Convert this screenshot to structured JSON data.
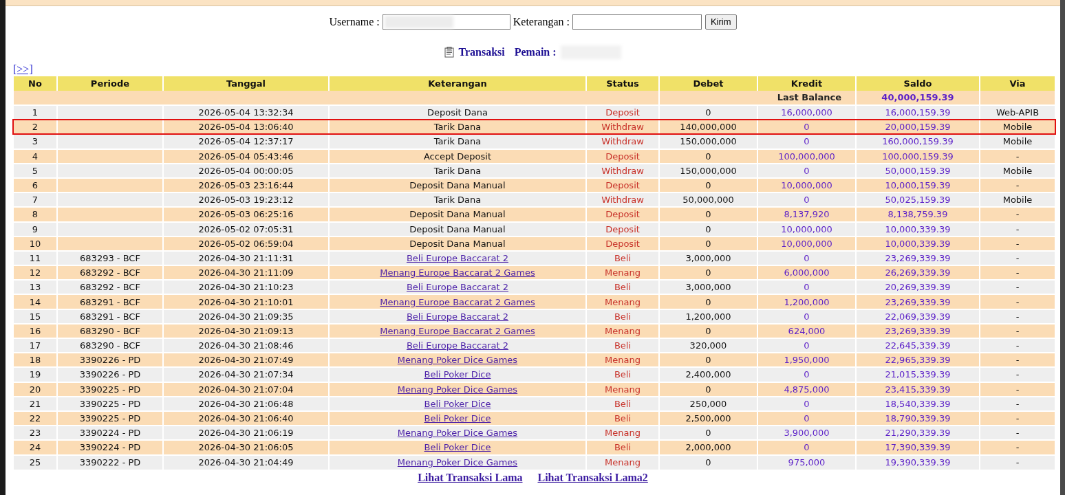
{
  "form": {
    "username_label": "Username :",
    "keterangan_label": "Keterangan :",
    "submit": "Kirim"
  },
  "heading": {
    "title": "Transaksi",
    "player_label": "Pemain :"
  },
  "next_link": "[>>]",
  "table": {
    "columns": [
      "No",
      "Periode",
      "Tanggal",
      "Keterangan",
      "Status",
      "Debet",
      "Kredit",
      "Saldo",
      "Via"
    ],
    "last_balance": {
      "label": "Last Balance",
      "value": "40,000,159.39"
    },
    "rows": [
      {
        "no": "1",
        "tanggal": "2026-05-04 13:32:34",
        "keterangan": "Deposit Dana",
        "link": false,
        "status": "Deposit",
        "debet": "0",
        "kredit": "16,000,000",
        "saldo": "16,000,159.39",
        "via": "Web-APIB",
        "highlighted": false
      },
      {
        "no": "2",
        "tanggal": "2026-05-04 13:06:40",
        "keterangan": "Tarik Dana",
        "link": false,
        "status": "Withdraw",
        "debet": "140,000,000",
        "kredit": "0",
        "saldo": "20,000,159.39",
        "via": "Mobile",
        "highlighted": true
      },
      {
        "no": "3",
        "tanggal": "2026-05-04 12:37:17",
        "keterangan": "Tarik Dana",
        "link": false,
        "status": "Withdraw",
        "debet": "150,000,000",
        "kredit": "0",
        "saldo": "160,000,159.39",
        "via": "Mobile",
        "highlighted": false
      },
      {
        "no": "4",
        "tanggal": "2026-05-04 05:43:46",
        "keterangan": "Accept Deposit",
        "link": false,
        "status": "Deposit",
        "debet": "0",
        "kredit": "100,000,000",
        "saldo": "100,000,159.39",
        "via": "-",
        "highlighted": false
      },
      {
        "no": "5",
        "tanggal": "2026-05-04 00:00:05",
        "keterangan": "Tarik Dana",
        "link": false,
        "status": "Withdraw",
        "debet": "150,000,000",
        "kredit": "0",
        "saldo": "50,000,159.39",
        "via": "Mobile",
        "highlighted": false
      },
      {
        "no": "6",
        "tanggal": "2026-05-03 23:16:44",
        "keterangan": "Deposit Dana Manual",
        "link": false,
        "status": "Deposit",
        "debet": "0",
        "kredit": "10,000,000",
        "saldo": "10,000,159.39",
        "via": "-",
        "highlighted": false
      },
      {
        "no": "7",
        "tanggal": "2026-05-03 19:23:12",
        "keterangan": "Tarik Dana",
        "link": false,
        "status": "Withdraw",
        "debet": "50,000,000",
        "kredit": "0",
        "saldo": "50,025,159.39",
        "via": "Mobile",
        "highlighted": false
      },
      {
        "no": "8",
        "tanggal": "2026-05-03 06:25:16",
        "keterangan": "Deposit Dana Manual",
        "link": false,
        "status": "Deposit",
        "debet": "0",
        "kredit": "8,137,920",
        "saldo": "8,138,759.39",
        "via": "-",
        "highlighted": false
      },
      {
        "no": "9",
        "tanggal": "2026-05-02 07:05:31",
        "keterangan": "Deposit Dana Manual",
        "link": false,
        "status": "Deposit",
        "debet": "0",
        "kredit": "10,000,000",
        "saldo": "10,000,339.39",
        "via": "-",
        "highlighted": false
      },
      {
        "no": "10",
        "tanggal": "2026-05-02 06:59:04",
        "keterangan": "Deposit Dana Manual",
        "link": false,
        "status": "Deposit",
        "debet": "0",
        "kredit": "10,000,000",
        "saldo": "10,000,339.39",
        "via": "-",
        "highlighted": false
      },
      {
        "no": "11",
        "periode": "683293 - BCF",
        "tanggal": "2026-04-30 21:11:31",
        "keterangan": "Beli Europe Baccarat 2",
        "link": true,
        "status": "Beli",
        "debet": "3,000,000",
        "kredit": "0",
        "saldo": "23,269,339.39",
        "via": "-",
        "highlighted": false
      },
      {
        "no": "12",
        "periode": "683292 - BCF",
        "tanggal": "2026-04-30 21:11:09",
        "keterangan": "Menang Europe Baccarat 2 Games",
        "link": true,
        "status": "Menang",
        "debet": "0",
        "kredit": "6,000,000",
        "saldo": "26,269,339.39",
        "via": "-",
        "highlighted": false
      },
      {
        "no": "13",
        "periode": "683292 - BCF",
        "tanggal": "2026-04-30 21:10:23",
        "keterangan": "Beli Europe Baccarat 2",
        "link": true,
        "status": "Beli",
        "debet": "3,000,000",
        "kredit": "0",
        "saldo": "20,269,339.39",
        "via": "-",
        "highlighted": false
      },
      {
        "no": "14",
        "periode": "683291 - BCF",
        "tanggal": "2026-04-30 21:10:01",
        "keterangan": "Menang Europe Baccarat 2 Games",
        "link": true,
        "status": "Menang",
        "debet": "0",
        "kredit": "1,200,000",
        "saldo": "23,269,339.39",
        "via": "-",
        "highlighted": false
      },
      {
        "no": "15",
        "periode": "683291 - BCF",
        "tanggal": "2026-04-30 21:09:35",
        "keterangan": "Beli Europe Baccarat 2",
        "link": true,
        "status": "Beli",
        "debet": "1,200,000",
        "kredit": "0",
        "saldo": "22,069,339.39",
        "via": "-",
        "highlighted": false
      },
      {
        "no": "16",
        "periode": "683290 - BCF",
        "tanggal": "2026-04-30 21:09:13",
        "keterangan": "Menang Europe Baccarat 2 Games",
        "link": true,
        "status": "Menang",
        "debet": "0",
        "kredit": "624,000",
        "saldo": "23,269,339.39",
        "via": "-",
        "highlighted": false
      },
      {
        "no": "17",
        "periode": "683290 - BCF",
        "tanggal": "2026-04-30 21:08:46",
        "keterangan": "Beli Europe Baccarat 2",
        "link": true,
        "status": "Beli",
        "debet": "320,000",
        "kredit": "0",
        "saldo": "22,645,339.39",
        "via": "-",
        "highlighted": false
      },
      {
        "no": "18",
        "periode": "3390226 - PD",
        "tanggal": "2026-04-30 21:07:49",
        "keterangan": "Menang Poker Dice Games",
        "link": true,
        "status": "Menang",
        "debet": "0",
        "kredit": "1,950,000",
        "saldo": "22,965,339.39",
        "via": "-",
        "highlighted": false
      },
      {
        "no": "19",
        "periode": "3390226 - PD",
        "tanggal": "2026-04-30 21:07:34",
        "keterangan": "Beli Poker Dice",
        "link": true,
        "status": "Beli",
        "debet": "2,400,000",
        "kredit": "0",
        "saldo": "21,015,339.39",
        "via": "-",
        "highlighted": false
      },
      {
        "no": "20",
        "periode": "3390225 - PD",
        "tanggal": "2026-04-30 21:07:04",
        "keterangan": "Menang Poker Dice Games",
        "link": true,
        "status": "Menang",
        "debet": "0",
        "kredit": "4,875,000",
        "saldo": "23,415,339.39",
        "via": "-",
        "highlighted": false
      },
      {
        "no": "21",
        "periode": "3390225 - PD",
        "tanggal": "2026-04-30 21:06:48",
        "keterangan": "Beli Poker Dice",
        "link": true,
        "status": "Beli",
        "debet": "250,000",
        "kredit": "0",
        "saldo": "18,540,339.39",
        "via": "-",
        "highlighted": false
      },
      {
        "no": "22",
        "periode": "3390225 - PD",
        "tanggal": "2026-04-30 21:06:40",
        "keterangan": "Beli Poker Dice",
        "link": true,
        "status": "Beli",
        "debet": "2,500,000",
        "kredit": "0",
        "saldo": "18,790,339.39",
        "via": "-",
        "highlighted": false
      },
      {
        "no": "23",
        "periode": "3390224 - PD",
        "tanggal": "2026-04-30 21:06:19",
        "keterangan": "Menang Poker Dice Games",
        "link": true,
        "status": "Menang",
        "debet": "0",
        "kredit": "3,900,000",
        "saldo": "21,290,339.39",
        "via": "-",
        "highlighted": false
      },
      {
        "no": "24",
        "periode": "3390224 - PD",
        "tanggal": "2026-04-30 21:06:05",
        "keterangan": "Beli Poker Dice",
        "link": true,
        "status": "Beli",
        "debet": "2,000,000",
        "kredit": "0",
        "saldo": "17,390,339.39",
        "via": "-",
        "highlighted": false
      },
      {
        "no": "25",
        "periode": "3390222 - PD",
        "tanggal": "2026-04-30 21:04:49",
        "keterangan": "Menang Poker Dice Games",
        "link": true,
        "status": "Menang",
        "debet": "0",
        "kredit": "975,000",
        "saldo": "19,390,339.39",
        "via": "-",
        "highlighted": false
      }
    ]
  },
  "footer_links": [
    "Lihat Transaksi Lama",
    "Lihat Transaksi Lama2"
  ]
}
